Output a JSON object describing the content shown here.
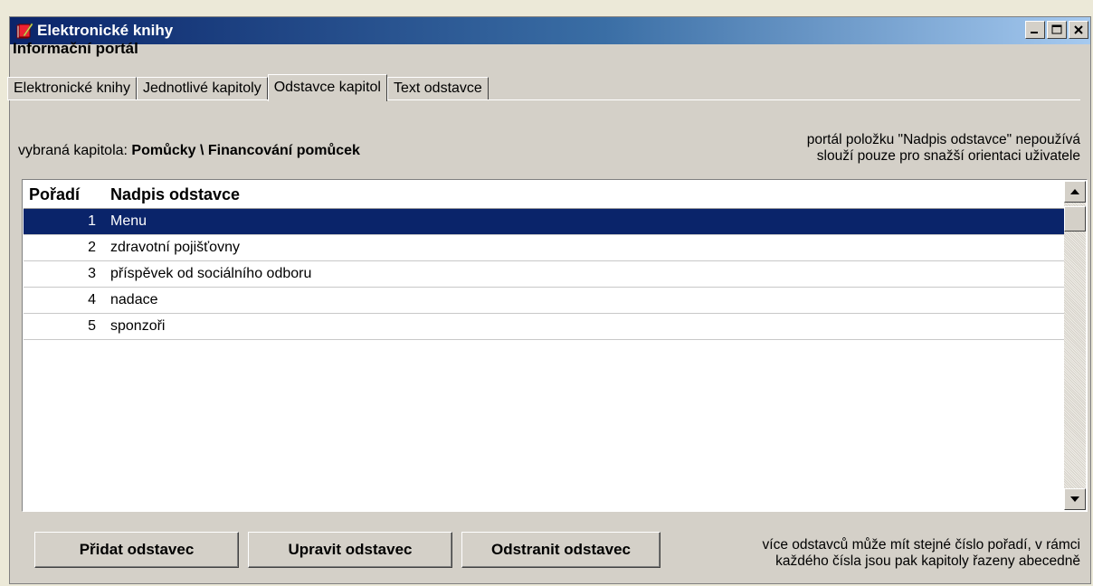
{
  "window": {
    "title": "Elektronické knihy",
    "controls": [
      "minimize",
      "maximize",
      "close"
    ]
  },
  "portal_label": "Informační portál",
  "tabs": [
    {
      "label": "Elektronické knihy",
      "active": false
    },
    {
      "label": "Jednotlivé kapitoly",
      "active": false
    },
    {
      "label": "Odstavce kapitol",
      "active": true
    },
    {
      "label": "Text odstavce",
      "active": false
    }
  ],
  "chapter": {
    "prefix": "vybraná kapitola:",
    "value": "Pomůcky \\ Financování pomůcek"
  },
  "note_top": {
    "line1": "portál položku \"Nadpis odstavce\" nepoužívá",
    "line2": "slouží pouze pro snažší orientaci uživatele"
  },
  "table": {
    "columns": [
      "Pořadí",
      "Nadpis odstavce"
    ],
    "rows": [
      {
        "order": "1",
        "title": "Menu",
        "selected": true
      },
      {
        "order": "2",
        "title": "zdravotní pojišťovny",
        "selected": false
      },
      {
        "order": "3",
        "title": "příspěvek od sociálního odboru",
        "selected": false
      },
      {
        "order": "4",
        "title": "nadace",
        "selected": false
      },
      {
        "order": "5",
        "title": "sponzoři",
        "selected": false
      }
    ]
  },
  "buttons": {
    "add": "Přidat odstavec",
    "edit": "Upravit odstavec",
    "delete": "Odstranit odstavec"
  },
  "note_bottom": {
    "line1": "více odstavců může mít stejné číslo pořadí, v rámci",
    "line2": "každého čísla jsou pak kapitoly řazeny abecedně"
  },
  "colors": {
    "titlebar_start": "#0a246a",
    "titlebar_end": "#a6caf0",
    "selection": "#0a246a",
    "face": "#d4d0c8"
  }
}
